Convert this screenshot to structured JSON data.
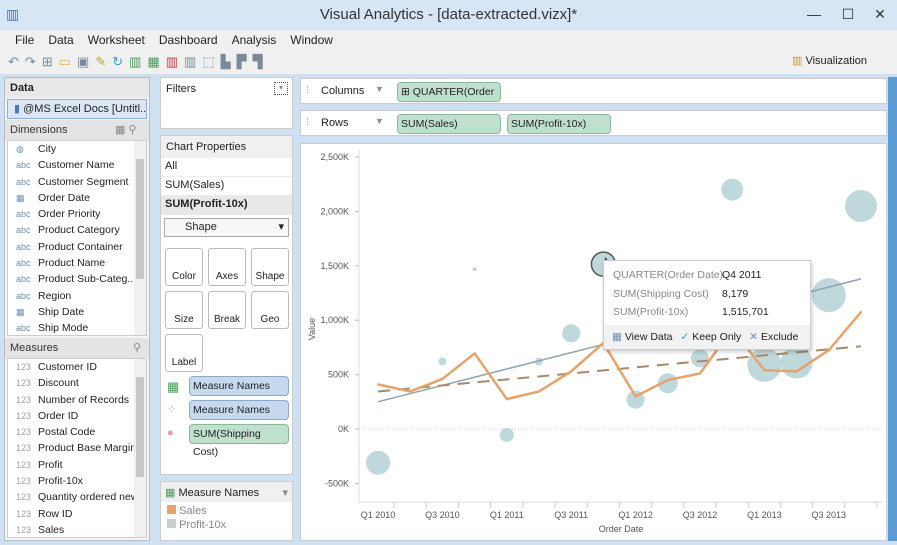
{
  "window": {
    "title": "Visual Analytics - [data-extracted.vizx]*",
    "min": "—",
    "max": "☐",
    "close": "✕"
  },
  "menu": [
    "File",
    "Data",
    "Worksheet",
    "Dashboard",
    "Analysis",
    "Window"
  ],
  "toolbar": {
    "visualization_label": "Visualization"
  },
  "data_panel": {
    "title": "Data",
    "source": "@MS Excel Docs [Untitl...",
    "dimensions_label": "Dimensions",
    "measures_label": "Measures",
    "dimensions": [
      {
        "icon": "globe",
        "label": "City"
      },
      {
        "icon": "abc",
        "label": "Customer Name"
      },
      {
        "icon": "abc",
        "label": "Customer Segment"
      },
      {
        "icon": "date",
        "label": "Order Date"
      },
      {
        "icon": "abc",
        "label": "Order Priority"
      },
      {
        "icon": "abc",
        "label": "Product Category"
      },
      {
        "icon": "abc",
        "label": "Product Container"
      },
      {
        "icon": "abc",
        "label": "Product Name"
      },
      {
        "icon": "abc",
        "label": "Product Sub-Categ..."
      },
      {
        "icon": "abc",
        "label": "Region"
      },
      {
        "icon": "date",
        "label": "Ship Date"
      },
      {
        "icon": "abc",
        "label": "Ship Mode"
      }
    ],
    "measures": [
      "Customer ID",
      "Discount",
      "Number of Records",
      "Order ID",
      "Postal Code",
      "Product Base Margin",
      "Profit",
      "Profit-10x",
      "Quantity ordered new",
      "Row ID",
      "Sales"
    ],
    "icon_texts": {
      "abc": "abc",
      "num": "123",
      "globe": "◍",
      "date": "▦"
    }
  },
  "filters": {
    "title": "Filters"
  },
  "chart_properties": {
    "title": "Chart Properties",
    "items": [
      "All",
      "SUM(Sales)",
      "SUM(Profit-10x)"
    ],
    "mark_type": "Shape",
    "cards": [
      "Color",
      "Axes",
      "Shape",
      "Size",
      "Break",
      "Geo",
      "Label"
    ],
    "pills": [
      "Measure Names",
      "Measure Names",
      "SUM(Shipping Cost)"
    ]
  },
  "legend": {
    "title": "Measure Names",
    "items": [
      {
        "label": "Sales",
        "color": "#e8a26a"
      },
      {
        "label": "Profit-10x",
        "color": "#c8cdd2"
      }
    ]
  },
  "shelves": {
    "columns_label": "Columns",
    "columns_pill": "⊞ QUARTER(Order ...",
    "rows_label": "Rows",
    "rows_pills": [
      "SUM(Sales)",
      "SUM(Profit-10x)"
    ]
  },
  "tooltip": {
    "rows": [
      {
        "k": "QUARTER(Order Date)",
        "v": "Q4 2011"
      },
      {
        "k": "SUM(Shipping Cost)",
        "v": "8,179"
      },
      {
        "k": "SUM(Profit-10x)",
        "v": "1,515,701"
      }
    ],
    "actions": [
      "View Data",
      "Keep Only",
      "Exclude"
    ]
  },
  "chart_data": {
    "type": "line+scatter",
    "xlabel": "Order Date",
    "ylabel": "Value",
    "ylim": [
      -650,
      2600
    ],
    "yticks": [
      {
        "v": 2500,
        "label": "2,500K"
      },
      {
        "v": 2000,
        "label": "2,000K"
      },
      {
        "v": 1500,
        "label": "1,500K"
      },
      {
        "v": 1000,
        "label": "1,000K"
      },
      {
        "v": 500,
        "label": "500K"
      },
      {
        "v": 0,
        "label": "0K"
      },
      {
        "v": -500,
        "label": "-500K"
      }
    ],
    "quarters": [
      "Q1 2010",
      "Q2 2010",
      "Q3 2010",
      "Q4 2010",
      "Q1 2011",
      "Q2 2011",
      "Q3 2011",
      "Q4 2011",
      "Q1 2012",
      "Q2 2012",
      "Q3 2012",
      "Q4 2012",
      "Q1 2013",
      "Q2 2013",
      "Q3 2013",
      "Q4 2013"
    ],
    "xtick_labels": [
      "Q1 2010",
      "Q3 2010",
      "Q1 2011",
      "Q3 2011",
      "Q1 2012",
      "Q3 2012",
      "Q1 2013",
      "Q3 2013"
    ],
    "series": [
      {
        "name": "Sales",
        "type": "line",
        "color": "#e8a26a",
        "values": [
          410,
          345,
          460,
          695,
          275,
          345,
          530,
          790,
          300,
          450,
          510,
          920,
          540,
          530,
          725,
          1075
        ]
      },
      {
        "name": "Profit-10x",
        "type": "bubble",
        "color": "#a9cbd0",
        "values": [
          -310,
          null,
          620,
          1470,
          -55,
          620,
          880,
          1515,
          270,
          420,
          650,
          2200,
          590,
          610,
          1230,
          2050
        ],
        "sizes": [
          12,
          0,
          4,
          2,
          7,
          4,
          9,
          12,
          9,
          10,
          9,
          11,
          17,
          16,
          17,
          16
        ]
      }
    ],
    "trendlines": [
      {
        "name": "Profit-10x trend",
        "style": "solid",
        "color": "#8fa4ad",
        "from": 250,
        "to": 1380
      },
      {
        "name": "Sales trend",
        "style": "dashed",
        "color": "#a88a6a",
        "from": 345,
        "to": 760
      }
    ]
  }
}
